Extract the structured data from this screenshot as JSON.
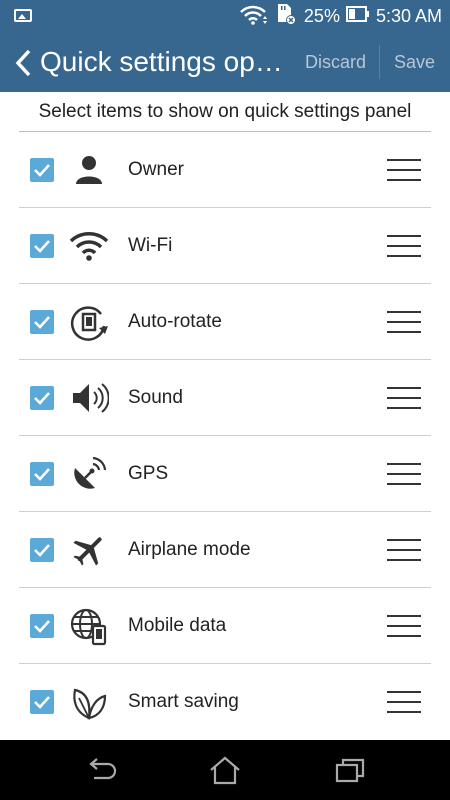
{
  "status_bar": {
    "battery_text": "25%",
    "time": "5:30 AM",
    "icons": [
      "image-notification-icon",
      "wifi-icon",
      "sd-card-icon",
      "battery-icon"
    ]
  },
  "app_bar": {
    "title": "Quick settings op…",
    "discard_label": "Discard",
    "save_label": "Save",
    "background": "#37668e"
  },
  "subtitle": "Select items to show on quick settings panel",
  "items": [
    {
      "label": "Owner",
      "icon": "person-icon",
      "checked": true
    },
    {
      "label": "Wi-Fi",
      "icon": "wifi-icon",
      "checked": true
    },
    {
      "label": "Auto-rotate",
      "icon": "auto-rotate-icon",
      "checked": true
    },
    {
      "label": "Sound",
      "icon": "speaker-icon",
      "checked": true
    },
    {
      "label": "GPS",
      "icon": "satellite-dish-icon",
      "checked": true
    },
    {
      "label": "Airplane mode",
      "icon": "airplane-icon",
      "checked": true
    },
    {
      "label": "Mobile data",
      "icon": "globe-phone-icon",
      "checked": true
    },
    {
      "label": "Smart saving",
      "icon": "leaf-icon",
      "checked": true
    }
  ],
  "colors": {
    "checkbox": "#5aa9d6",
    "accent": "#37668e"
  },
  "nav_bar": {
    "buttons": [
      "back-icon",
      "home-icon",
      "recents-icon"
    ]
  }
}
